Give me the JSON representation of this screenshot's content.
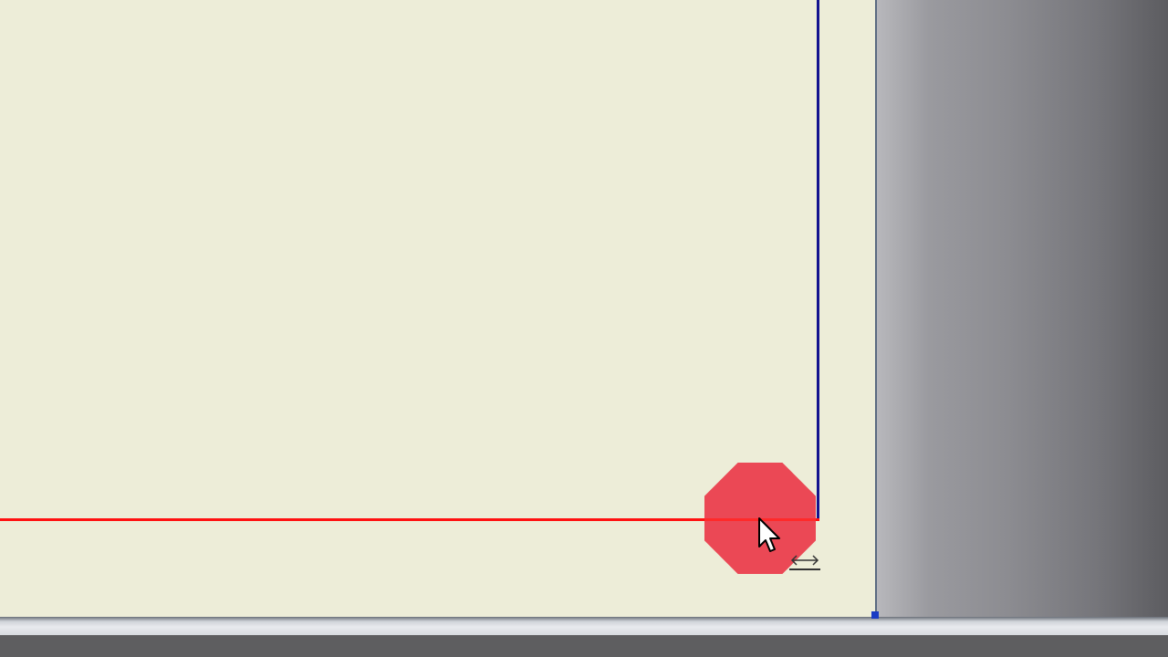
{
  "canvas": {
    "background_color": "#ededd8",
    "workspace_color": "#8c8c91"
  },
  "drawing": {
    "vertical_line_color": "#13138f",
    "horizontal_line_color": "#ff1111"
  },
  "indicator": {
    "shape": "octagon",
    "color": "#ea3a4a"
  },
  "cursor": {
    "icon": "arrow-cursor-icon",
    "secondary_icon": "horizontal-resize-icon"
  }
}
